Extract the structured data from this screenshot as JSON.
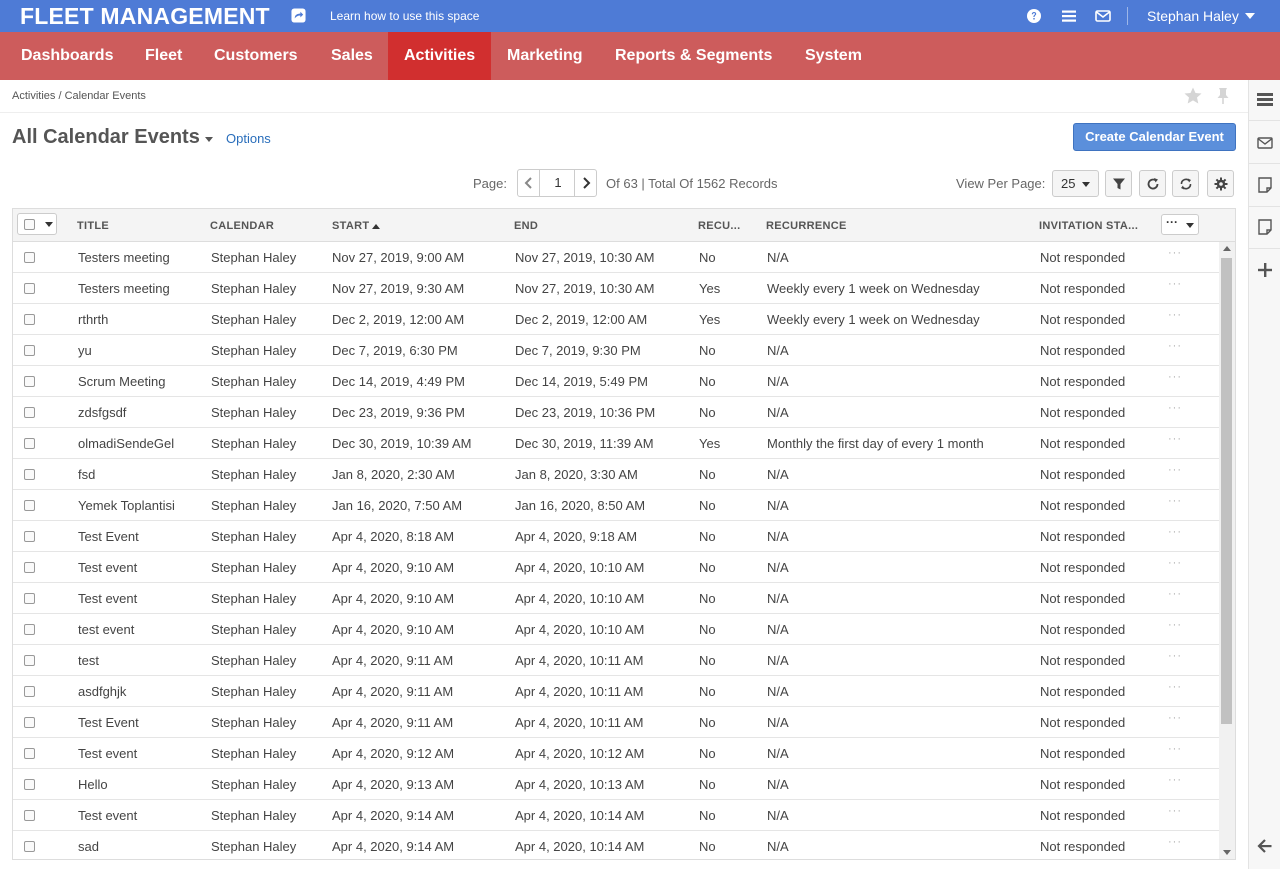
{
  "app": {
    "brand": "FLEET MANAGEMENT",
    "learn_link": "Learn how to use this space",
    "user_name": "Stephan Haley"
  },
  "nav": {
    "items": [
      {
        "label": "Dashboards"
      },
      {
        "label": "Fleet"
      },
      {
        "label": "Customers"
      },
      {
        "label": "Sales"
      },
      {
        "label": "Activities",
        "active": true
      },
      {
        "label": "Marketing"
      },
      {
        "label": "Reports & Segments"
      },
      {
        "label": "System"
      }
    ]
  },
  "breadcrumb": "Activities / Calendar Events",
  "page": {
    "title": "All Calendar Events",
    "options_label": "Options",
    "create_button": "Create Calendar Event"
  },
  "pagination": {
    "page_label": "Page:",
    "current_page": "1",
    "total_text": "Of 63 | Total Of 1562 Records",
    "view_per_page_label": "View Per Page:",
    "per_page": "25"
  },
  "grid": {
    "columns": {
      "title": "TITLE",
      "calendar": "CALENDAR",
      "start": "START",
      "end": "END",
      "recurring": "RECU...",
      "recurrence": "RECURRENCE",
      "invitation": "INVITATION STA..."
    },
    "rows": [
      {
        "title": "Testers meeting",
        "calendar": "Stephan Haley",
        "start": "Nov 27, 2019, 9:00 AM",
        "end": "Nov 27, 2019, 10:30 AM",
        "recurring": "No",
        "recurrence": "N/A",
        "invitation": "Not responded"
      },
      {
        "title": "Testers meeting",
        "calendar": "Stephan Haley",
        "start": "Nov 27, 2019, 9:30 AM",
        "end": "Nov 27, 2019, 10:30 AM",
        "recurring": "Yes",
        "recurrence": "Weekly every 1 week on Wednesday",
        "invitation": "Not responded"
      },
      {
        "title": "rthrth",
        "calendar": "Stephan Haley",
        "start": "Dec 2, 2019, 12:00 AM",
        "end": "Dec 2, 2019, 12:00 AM",
        "recurring": "Yes",
        "recurrence": "Weekly every 1 week on Wednesday",
        "invitation": "Not responded"
      },
      {
        "title": "yu",
        "calendar": "Stephan Haley",
        "start": "Dec 7, 2019, 6:30 PM",
        "end": "Dec 7, 2019, 9:30 PM",
        "recurring": "No",
        "recurrence": "N/A",
        "invitation": "Not responded"
      },
      {
        "title": "Scrum Meeting",
        "calendar": "Stephan Haley",
        "start": "Dec 14, 2019, 4:49 PM",
        "end": "Dec 14, 2019, 5:49 PM",
        "recurring": "No",
        "recurrence": "N/A",
        "invitation": "Not responded"
      },
      {
        "title": "zdsfgsdf",
        "calendar": "Stephan Haley",
        "start": "Dec 23, 2019, 9:36 PM",
        "end": "Dec 23, 2019, 10:36 PM",
        "recurring": "No",
        "recurrence": "N/A",
        "invitation": "Not responded"
      },
      {
        "title": "olmadiSendeGel",
        "calendar": "Stephan Haley",
        "start": "Dec 30, 2019, 10:39 AM",
        "end": "Dec 30, 2019, 11:39 AM",
        "recurring": "Yes",
        "recurrence": "Monthly the first day of every 1 month",
        "invitation": "Not responded"
      },
      {
        "title": "fsd",
        "calendar": "Stephan Haley",
        "start": "Jan 8, 2020, 2:30 AM",
        "end": "Jan 8, 2020, 3:30 AM",
        "recurring": "No",
        "recurrence": "N/A",
        "invitation": "Not responded"
      },
      {
        "title": "Yemek Toplantisi",
        "calendar": "Stephan Haley",
        "start": "Jan 16, 2020, 7:50 AM",
        "end": "Jan 16, 2020, 8:50 AM",
        "recurring": "No",
        "recurrence": "N/A",
        "invitation": "Not responded"
      },
      {
        "title": "Test Event",
        "calendar": "Stephan Haley",
        "start": "Apr 4, 2020, 8:18 AM",
        "end": "Apr 4, 2020, 9:18 AM",
        "recurring": "No",
        "recurrence": "N/A",
        "invitation": "Not responded"
      },
      {
        "title": "Test event",
        "calendar": "Stephan Haley",
        "start": "Apr 4, 2020, 9:10 AM",
        "end": "Apr 4, 2020, 10:10 AM",
        "recurring": "No",
        "recurrence": "N/A",
        "invitation": "Not responded"
      },
      {
        "title": "Test event",
        "calendar": "Stephan Haley",
        "start": "Apr 4, 2020, 9:10 AM",
        "end": "Apr 4, 2020, 10:10 AM",
        "recurring": "No",
        "recurrence": "N/A",
        "invitation": "Not responded"
      },
      {
        "title": "test event",
        "calendar": "Stephan Haley",
        "start": "Apr 4, 2020, 9:10 AM",
        "end": "Apr 4, 2020, 10:10 AM",
        "recurring": "No",
        "recurrence": "N/A",
        "invitation": "Not responded"
      },
      {
        "title": "test",
        "calendar": "Stephan Haley",
        "start": "Apr 4, 2020, 9:11 AM",
        "end": "Apr 4, 2020, 10:11 AM",
        "recurring": "No",
        "recurrence": "N/A",
        "invitation": "Not responded"
      },
      {
        "title": "asdfghjk",
        "calendar": "Stephan Haley",
        "start": "Apr 4, 2020, 9:11 AM",
        "end": "Apr 4, 2020, 10:11 AM",
        "recurring": "No",
        "recurrence": "N/A",
        "invitation": "Not responded"
      },
      {
        "title": "Test Event",
        "calendar": "Stephan Haley",
        "start": "Apr 4, 2020, 9:11 AM",
        "end": "Apr 4, 2020, 10:11 AM",
        "recurring": "No",
        "recurrence": "N/A",
        "invitation": "Not responded"
      },
      {
        "title": "Test event",
        "calendar": "Stephan Haley",
        "start": "Apr 4, 2020, 9:12 AM",
        "end": "Apr 4, 2020, 10:12 AM",
        "recurring": "No",
        "recurrence": "N/A",
        "invitation": "Not responded"
      },
      {
        "title": "Hello",
        "calendar": "Stephan Haley",
        "start": "Apr 4, 2020, 9:13 AM",
        "end": "Apr 4, 2020, 10:13 AM",
        "recurring": "No",
        "recurrence": "N/A",
        "invitation": "Not responded"
      },
      {
        "title": "Test event",
        "calendar": "Stephan Haley",
        "start": "Apr 4, 2020, 9:14 AM",
        "end": "Apr 4, 2020, 10:14 AM",
        "recurring": "No",
        "recurrence": "N/A",
        "invitation": "Not responded"
      },
      {
        "title": "sad",
        "calendar": "Stephan Haley",
        "start": "Apr 4, 2020, 9:14 AM",
        "end": "Apr 4, 2020, 10:14 AM",
        "recurring": "No",
        "recurrence": "N/A",
        "invitation": "Not responded"
      }
    ]
  },
  "colors": {
    "topbar": "#4e7bd6",
    "nav": "#cd5c5c",
    "nav_active": "#d12f2f",
    "primary_button": "#5b8fdb",
    "link": "#2a6ebb"
  }
}
